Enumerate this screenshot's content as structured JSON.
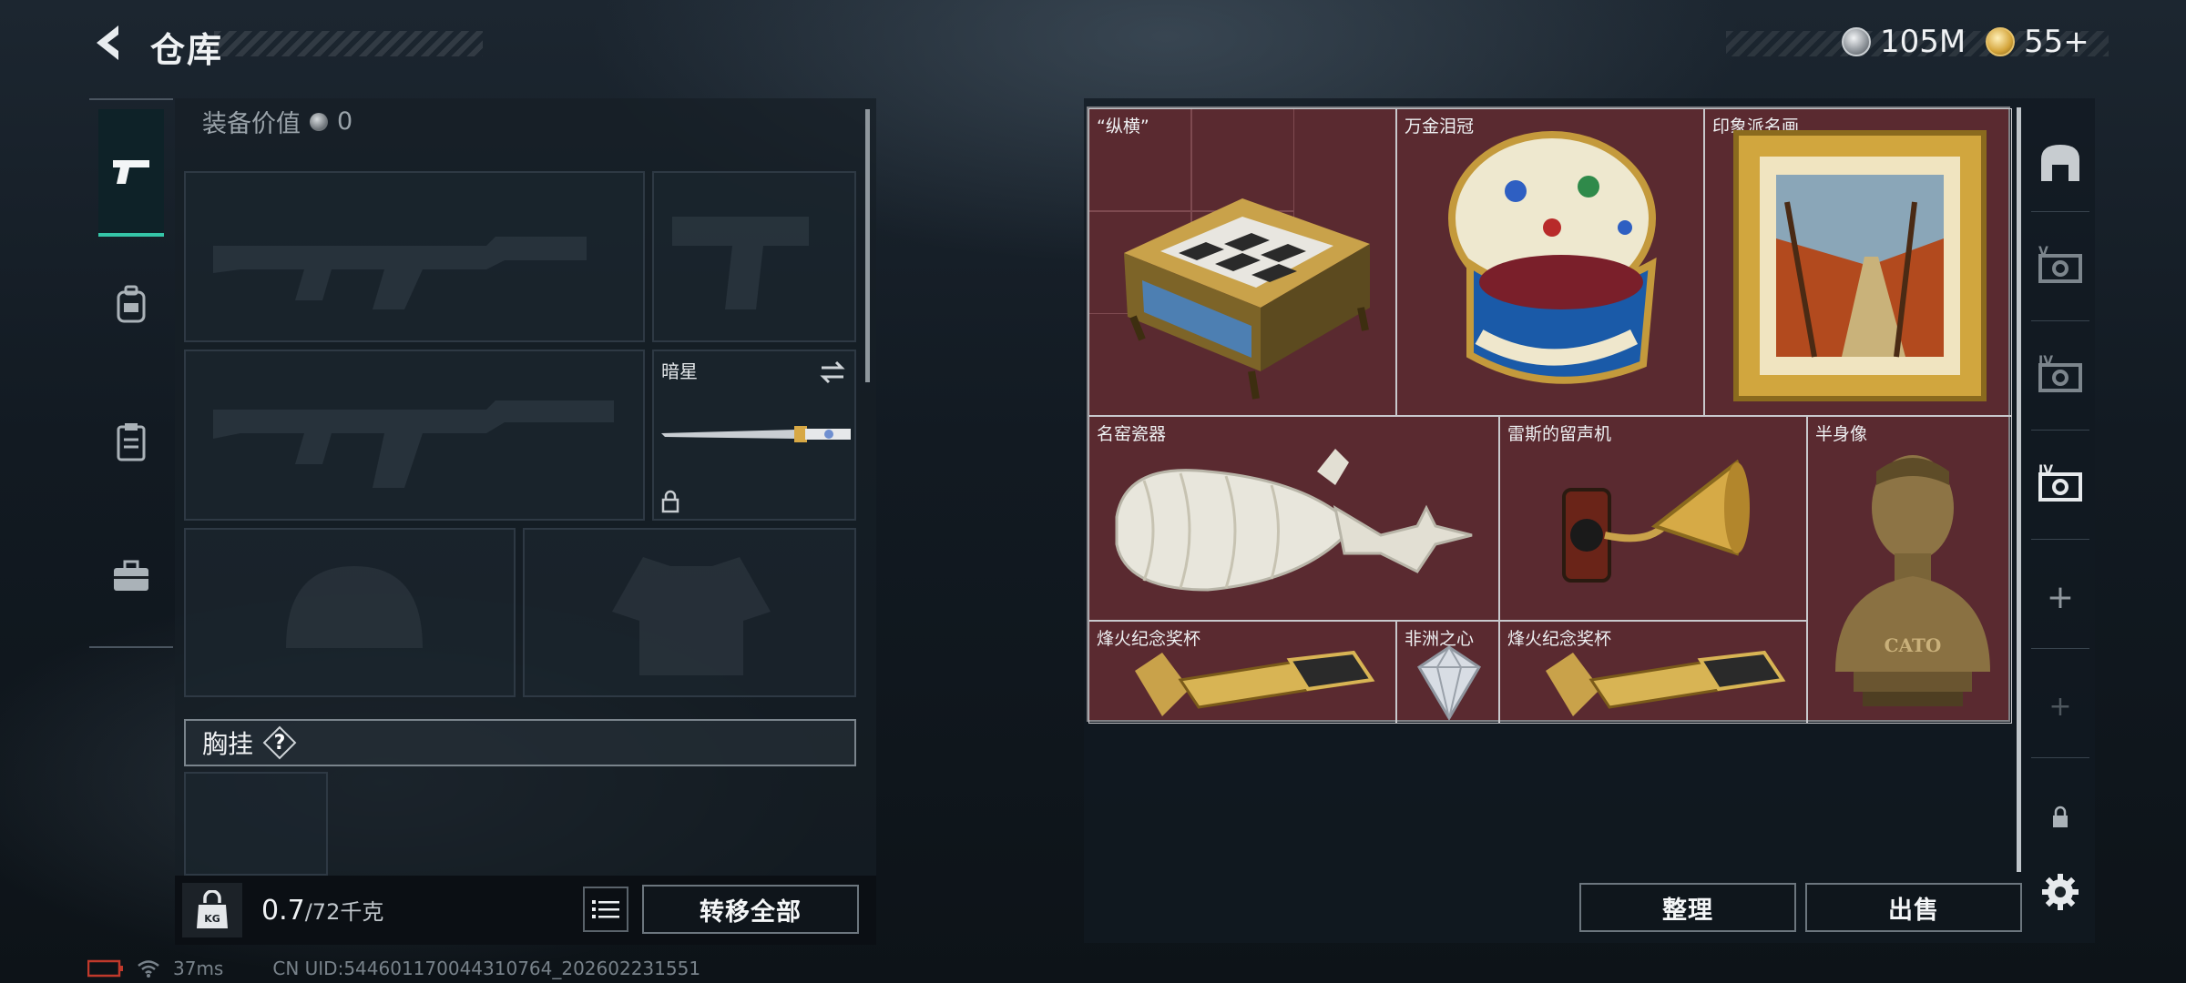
{
  "header": {
    "title": "仓库",
    "currencies": [
      {
        "icon": "silver-coin-icon",
        "value": "105M"
      },
      {
        "icon": "gold-token-icon",
        "value": "55+"
      }
    ]
  },
  "left_tabs": [
    {
      "icon": "pistol-icon",
      "active": true
    },
    {
      "icon": "backpack-icon",
      "active": false
    },
    {
      "icon": "clipboard-icon",
      "active": false
    },
    {
      "icon": "briefcase-icon",
      "active": false
    }
  ],
  "loadout": {
    "equip_value_label": "装备价值",
    "equip_value": "0",
    "melee_name": "暗星",
    "rig_label": "胸挂",
    "rig_help": "?",
    "weight_current": "0.7",
    "weight_max": "/72千克",
    "weight_icon_label": "KG",
    "transfer_all": "转移全部"
  },
  "stash": {
    "items": [
      {
        "name": "“纵横”",
        "icon": "chess-set-icon"
      },
      {
        "name": "万金泪冠",
        "icon": "jeweled-egg-icon"
      },
      {
        "name": "印象派名画",
        "icon": "framed-painting-icon"
      },
      {
        "name": "名窑瓷器",
        "icon": "porcelain-vessel-icon"
      },
      {
        "name": "雷斯的留声机",
        "icon": "gramophone-icon"
      },
      {
        "name": "半身像",
        "icon": "bust-statue-icon",
        "inscription": "CATO"
      },
      {
        "name": "烽火纪念奖杯",
        "icon": "trophy-icon"
      },
      {
        "name": "非洲之心",
        "icon": "diamond-icon"
      },
      {
        "name": "烽火纪念奖杯",
        "icon": "trophy-icon"
      }
    ],
    "organize": "整理",
    "sell": "出售",
    "side_labels": {
      "v": "V",
      "iv": "IV",
      "iv2": "IV",
      "add": "+"
    }
  },
  "status": {
    "ping": "37ms",
    "uid": "CN UID:544601170044310764_202602231551"
  }
}
